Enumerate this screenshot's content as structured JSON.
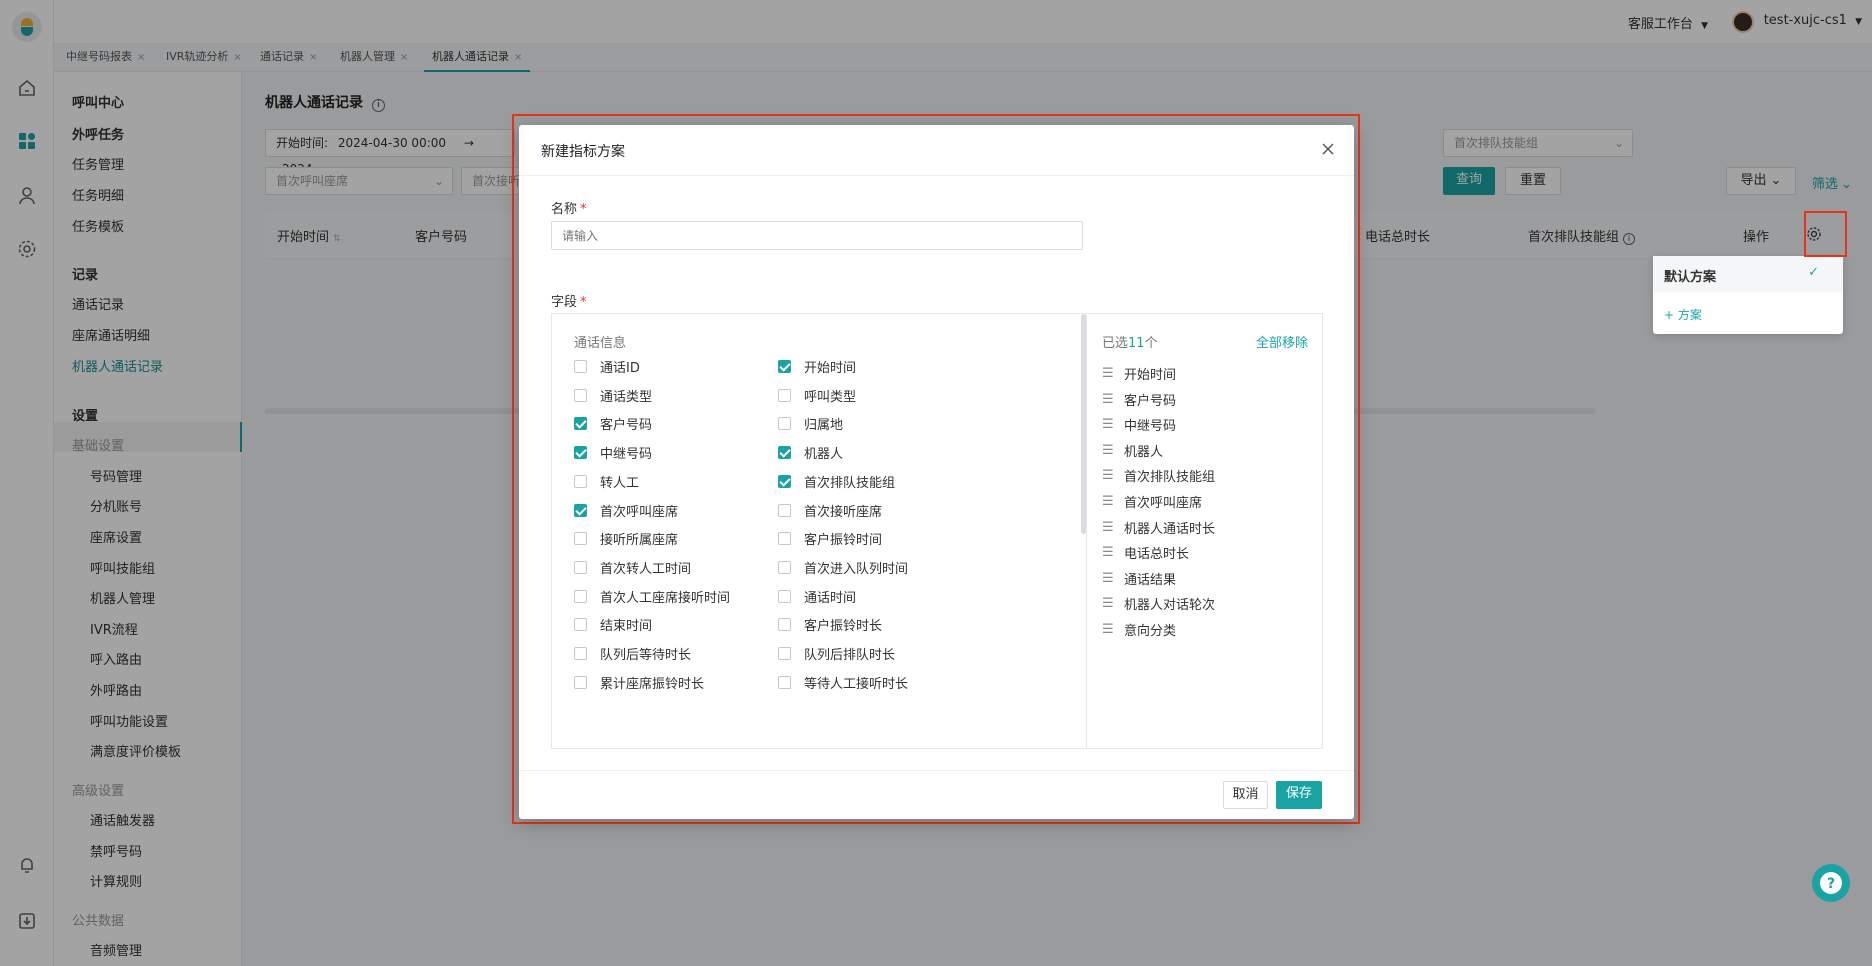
{
  "header": {
    "workspace": "客服工作台",
    "username": "test-xujc-cs1"
  },
  "tabs": [
    {
      "label": "中继号码报表",
      "close": "×"
    },
    {
      "label": "IVR轨迹分析",
      "close": "×"
    },
    {
      "label": "通话记录",
      "close": "×"
    },
    {
      "label": "机器人管理",
      "close": "×"
    },
    {
      "label": "机器人通话记录",
      "close": "×"
    }
  ],
  "sidebar": {
    "call_center": "呼叫中心",
    "outbound_task": "外呼任务",
    "task_mgmt": "任务管理",
    "task_detail": "任务明细",
    "task_template": "任务模板",
    "records": "记录",
    "call_records": "通话记录",
    "seat_detail": "座席通话明细",
    "robot_records": "机器人通话记录",
    "settings": "设置",
    "basic_settings": "基础设置",
    "number_mgmt": "号码管理",
    "ext_account": "分机账号",
    "seat_settings": "座席设置",
    "skill_group": "呼叫技能组",
    "robot_mgmt": "机器人管理",
    "ivr_flow": "IVR流程",
    "inbound_route": "呼入路由",
    "outbound_route": "外呼路由",
    "call_features": "呼叫功能设置",
    "satisfaction": "满意度评价模板",
    "advanced_settings": "高级设置",
    "call_trigger": "通话触发器",
    "blocked_numbers": "禁呼号码",
    "billing_rules": "计算规则",
    "public_data": "公共数据",
    "audio_mgmt": "音频管理"
  },
  "main": {
    "page_title": "机器人通话记录",
    "filter_time_label": "开始时间:",
    "filter_time_start": "2024-04-30 00:00",
    "filter_time_arrow": "→",
    "filter_time_end_partial": "2024",
    "filter_first_queue_skill": "首次排队技能组",
    "filter_first_call_seat": "首次呼叫座席",
    "filter_first_answer_partial": "首次接听",
    "query_button": "查询",
    "reset_button": "重置",
    "export_button": "导出",
    "filter_link": "筛选",
    "table_headers": {
      "start_time": "开始时间",
      "customer_number": "客户号码",
      "total_duration": "电话总时长",
      "first_queue_skill": "首次排队技能组",
      "action": "操作"
    }
  },
  "column_menu": {
    "default_scheme": "默认方案",
    "add_scheme": "+ 方案"
  },
  "modal": {
    "title": "新建指标方案",
    "name_label": "名称",
    "required_mark": "*",
    "name_placeholder": "请输入",
    "fields_label": "字段",
    "group_title": "通话信息",
    "options": [
      {
        "label": "通话ID",
        "checked": false
      },
      {
        "label": "开始时间",
        "checked": true
      },
      {
        "label": "通话类型",
        "checked": false
      },
      {
        "label": "呼叫类型",
        "checked": false
      },
      {
        "label": "客户号码",
        "checked": true
      },
      {
        "label": "归属地",
        "checked": false
      },
      {
        "label": "中继号码",
        "checked": true
      },
      {
        "label": "机器人",
        "checked": true
      },
      {
        "label": "转人工",
        "checked": false
      },
      {
        "label": "首次排队技能组",
        "checked": true
      },
      {
        "label": "首次呼叫座席",
        "checked": true
      },
      {
        "label": "首次接听座席",
        "checked": false
      },
      {
        "label": "接听所属座席",
        "checked": false
      },
      {
        "label": "客户振铃时间",
        "checked": false
      },
      {
        "label": "首次转人工时间",
        "checked": false
      },
      {
        "label": "首次进入队列时间",
        "checked": false
      },
      {
        "label": "首次人工座席接听时间",
        "checked": false
      },
      {
        "label": "通话时间",
        "checked": false
      },
      {
        "label": "结束时间",
        "checked": false
      },
      {
        "label": "客户振铃时长",
        "checked": false
      },
      {
        "label": "队列后等待时长",
        "checked": false
      },
      {
        "label": "队列后排队时长",
        "checked": false
      },
      {
        "label": "累计座席振铃时长",
        "checked": false
      },
      {
        "label": "等待人工接听时长",
        "checked": false
      }
    ],
    "selected_prefix": "已选",
    "selected_count": "11",
    "selected_suffix": "个",
    "remove_all": "全部移除",
    "selected_items": [
      "开始时间",
      "客户号码",
      "中继号码",
      "机器人",
      "首次排队技能组",
      "首次呼叫座席",
      "机器人通话时长",
      "电话总时长",
      "通话结果",
      "机器人对话轮次",
      "意向分类"
    ],
    "cancel_button": "取消",
    "save_button": "保存"
  },
  "colors": {
    "accent": "#1aa3a3",
    "highlight_frame": "#e5341c"
  }
}
